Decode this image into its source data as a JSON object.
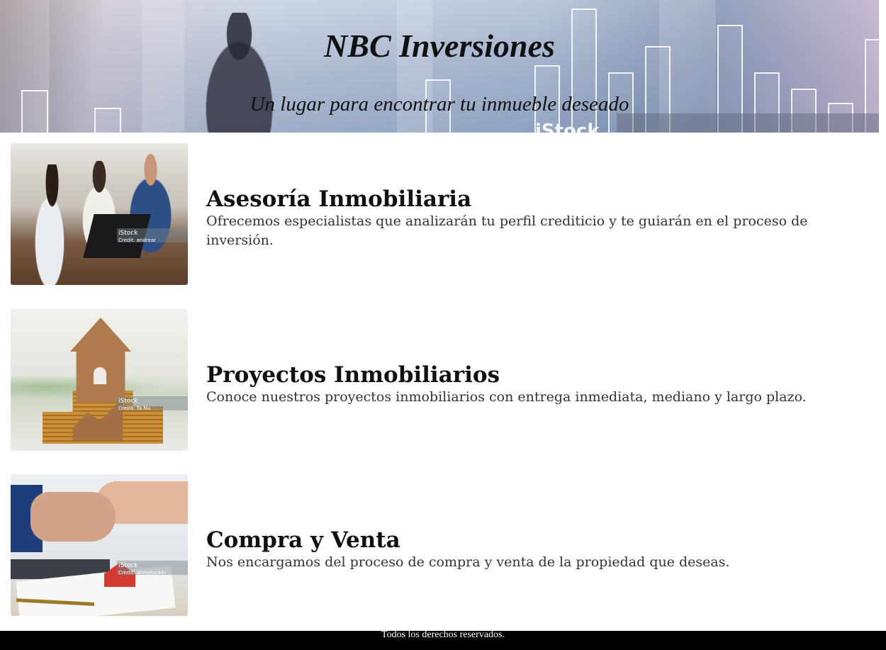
{
  "header": {
    "title": "NBC Inversiones",
    "subtitle": "Un lugar para encontrar tu inmueble deseado",
    "watermark": "iStock"
  },
  "services": [
    {
      "title": "Asesoría Inmobiliaria",
      "description": "Ofrecemos especialistas que analizarán tu perfil crediticio y te guiarán en el proceso de inversión.",
      "image_watermark": "iStock",
      "image_credit": "Credit: andrear"
    },
    {
      "title": "Proyectos Inmobiliarios",
      "description": "Conoce nuestros proyectos inmobiliarios con entrega inmediata, mediano y largo plazo.",
      "image_watermark": "iStock",
      "image_credit": "Credit: Ta Nu"
    },
    {
      "title": "Compra y Venta",
      "description": "Nos encargamos del proceso de compra y venta de la propiedad que deseas.",
      "image_watermark": "iStock",
      "image_credit": "Credit: ahmetocker"
    }
  ],
  "footer": {
    "text": "Todos los derechos reservados."
  }
}
